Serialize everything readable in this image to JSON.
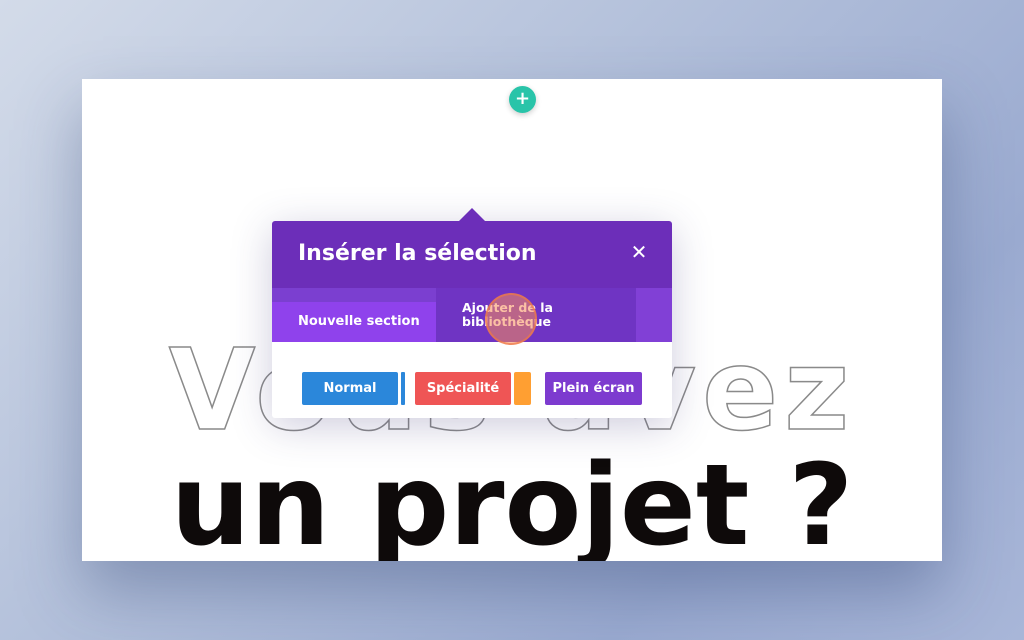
{
  "canvas": {
    "add_button_symbol": "+",
    "headline_outline": "Vous avez",
    "headline_solid": "un projet ?"
  },
  "modal": {
    "title": "Insérer la sélection",
    "close_symbol": "✕",
    "tabs": [
      {
        "label": "Nouvelle section",
        "active": true
      },
      {
        "label_line1": "Ajouter de la",
        "label_line2": "bibliothèque",
        "active": false
      }
    ],
    "layout_buttons": [
      {
        "label": "Normal",
        "color": "#2b87da"
      },
      {
        "label": "Spécialité",
        "color": "#ef5555"
      },
      {
        "label": "Plein écran",
        "color": "#7d3bcf"
      }
    ]
  },
  "colors": {
    "header_purple": "#6c2eb9",
    "tab_purple": "#8f42ec",
    "add_button_teal": "#29c4a9",
    "speciality_accent_orange": "#ff9f32"
  },
  "icons": {
    "add": "plus-icon",
    "close": "close-icon"
  }
}
